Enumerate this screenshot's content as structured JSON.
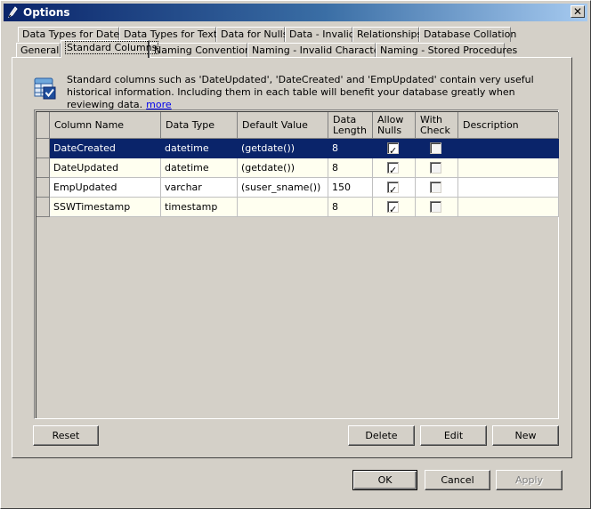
{
  "window": {
    "title": "Options"
  },
  "tabs_row1": [
    "Data Types for Dates",
    "Data Types for Text",
    "Data for Nulls",
    "Data - Invalid",
    "Relationships",
    "Database Collation"
  ],
  "tabs_row2": [
    "General",
    "Standard Columns",
    "Naming Conventions",
    "Naming - Invalid Characters",
    "Naming - Stored Procedures"
  ],
  "active_tab": "Standard Columns",
  "info": {
    "text": "Standard columns such as 'DateUpdated', 'DateCreated' and 'EmpUpdated' contain very useful historical information. Including them in each table will benefit your database greatly when reviewing data.",
    "link": "more"
  },
  "grid": {
    "headers": [
      "Column Name",
      "Data Type",
      "Default Value",
      "Data Length",
      "Allow Nulls",
      "With Check",
      "Description"
    ],
    "rows": [
      {
        "name": "DateCreated",
        "type": "datetime",
        "default": "(getdate())",
        "length": "8",
        "allow_nulls": true,
        "with_check": false,
        "description": "",
        "selected": true
      },
      {
        "name": "DateUpdated",
        "type": "datetime",
        "default": "(getdate())",
        "length": "8",
        "allow_nulls": true,
        "with_check": false,
        "description": ""
      },
      {
        "name": "EmpUpdated",
        "type": "varchar",
        "default": "(suser_sname())",
        "length": "150",
        "allow_nulls": true,
        "with_check": false,
        "description": ""
      },
      {
        "name": "SSWTimestamp",
        "type": "timestamp",
        "default": "",
        "length": "8",
        "allow_nulls": true,
        "with_check": false,
        "description": ""
      }
    ]
  },
  "buttons": {
    "reset": "Reset",
    "delete": "Delete",
    "edit": "Edit",
    "new": "New",
    "ok": "OK",
    "cancel": "Cancel",
    "apply": "Apply"
  },
  "colors": {
    "title_active": "#0a246a",
    "selection": "#0a246a",
    "row_alt": "#fffff0",
    "link": "#0000ee"
  }
}
